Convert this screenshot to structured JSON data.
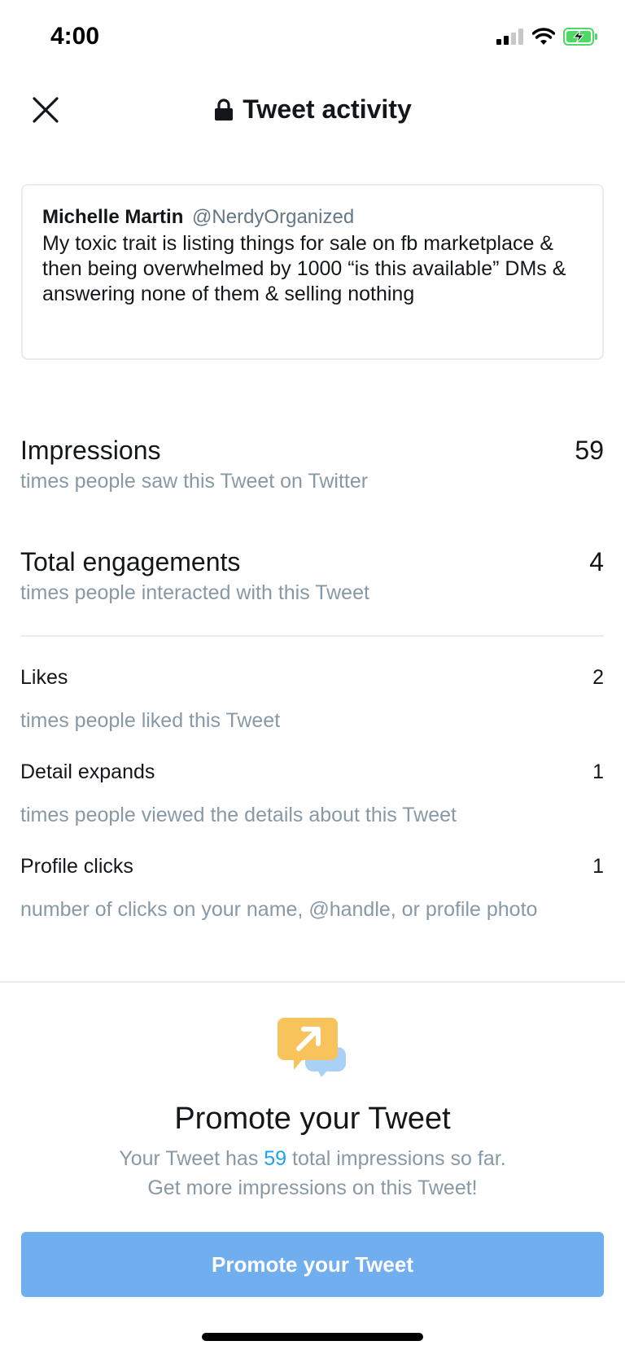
{
  "status_bar": {
    "time": "4:00"
  },
  "nav": {
    "title": "Tweet activity",
    "close_icon": "close-icon",
    "lock_icon": "lock-icon"
  },
  "tweet": {
    "author": "Michelle Martin",
    "handle": "@NerdyOrganized",
    "text": "My toxic trait is listing things for sale on fb marketplace & then being overwhelmed by 1000 “is this available” DMs & answering none of them & selling nothing"
  },
  "metrics": {
    "impressions": {
      "label": "Impressions",
      "value": "59",
      "description": "times people saw this Tweet on Twitter"
    },
    "engagements": {
      "label": "Total engagements",
      "value": "4",
      "description": "times people interacted with this Tweet"
    },
    "likes": {
      "label": "Likes",
      "value": "2",
      "description": "times people liked this Tweet"
    },
    "detail_expands": {
      "label": "Detail expands",
      "value": "1",
      "description": "times people viewed the details about this Tweet"
    },
    "profile_clicks": {
      "label": "Profile clicks",
      "value": "1",
      "description": "number of clicks on your name, @handle, or profile photo"
    }
  },
  "promote": {
    "icon": "promote-chat-icon",
    "title": "Promote your Tweet",
    "line1_prefix": "Your Tweet has ",
    "line1_count": "59",
    "line1_suffix": " total impressions so far.",
    "line2": "Get more impressions on this Tweet!",
    "button_label": "Promote your Tweet"
  },
  "colors": {
    "accent": "#1da1f2",
    "button": "#71aef0",
    "secondary_text": "#8899a6",
    "divider": "#e6ecf0",
    "battery_charging": "#4cd964"
  }
}
